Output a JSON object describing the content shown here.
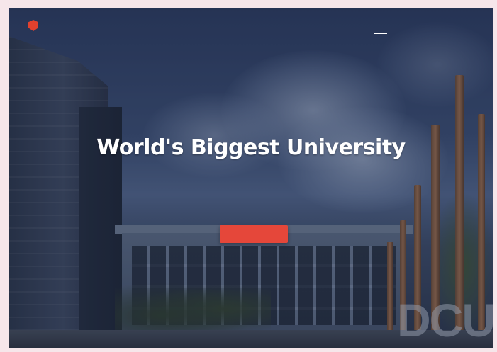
{
  "header": {
    "logo_text": "",
    "nav": [
      {
        "label": "",
        "active": true
      },
      {
        "label": "",
        "active": false
      },
      {
        "label": "",
        "active": false
      },
      {
        "label": "",
        "active": false
      },
      {
        "label": "",
        "active": false
      }
    ]
  },
  "hero": {
    "title": "World's Biggest University",
    "subtitle": "",
    "button_label": ""
  },
  "scene": {
    "building_sign": "DCU"
  },
  "colors": {
    "accent": "#e5473a",
    "logo_icon": "#e2412e",
    "overlay": "#1e2a48"
  },
  "icons": {
    "logo": "shield-logo-icon"
  }
}
